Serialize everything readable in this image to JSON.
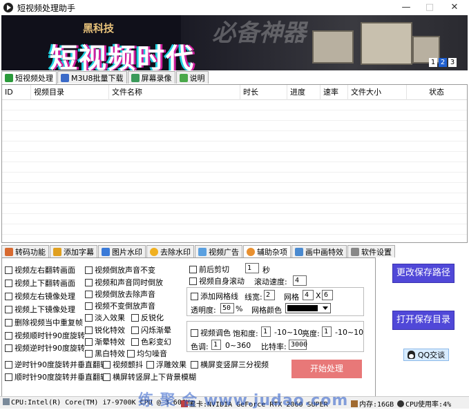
{
  "window": {
    "title": "短视频处理助手",
    "min": "—",
    "max": "□",
    "close": "✕"
  },
  "banner": {
    "tag": "黑科技",
    "headline": "短视频时代",
    "ghost_text": "必备神器",
    "pages": [
      "1",
      "2",
      "3"
    ],
    "active_page": 2
  },
  "top_tabs": [
    {
      "label": "短视频处理",
      "icon": "video-icon"
    },
    {
      "label": "M3U8批量下载",
      "icon": "grid-icon"
    },
    {
      "label": "屏幕录像",
      "icon": "screen-icon"
    },
    {
      "label": "说明",
      "icon": "help-icon"
    }
  ],
  "table": {
    "columns": [
      "ID",
      "视频目录",
      "文件名称",
      "时长",
      "进度",
      "速率",
      "文件大小",
      "状态"
    ]
  },
  "bottom_tabs": [
    {
      "label": "转码功能"
    },
    {
      "label": "添加字幕"
    },
    {
      "label": "图片水印"
    },
    {
      "label": "去除水印"
    },
    {
      "label": "视频广告"
    },
    {
      "label": "辅助杂项"
    },
    {
      "label": "画中画特效"
    },
    {
      "label": "软件设置"
    }
  ],
  "options": {
    "col1": [
      "视频左右翻转画面",
      "视频上下翻转画面",
      "视频左右镜像处理",
      "视频上下镜像处理",
      "删除视频当中重复帧",
      "视频顺时针90度旋转",
      "视频逆时针90度旋转"
    ],
    "col2": [
      "视频倒放声音不变",
      "视频和声音同时倒放",
      "视频倒放去除声音",
      "视频不变倒放声音",
      "淡入效果",
      "锐化特效",
      "渐晕特效",
      "黑白特效"
    ],
    "col3": [
      "反锐化",
      "闪烁渐晕",
      "色彩变幻",
      "均匀噪音"
    ],
    "row_a": [
      "逆时针90度旋转并垂直翻转",
      "视频颤抖",
      "浮雕效果",
      "横屏变竖屏三分视频"
    ],
    "row_b": [
      "顺时针90度旋转并垂直翻转",
      "横屏转竖屏上下背景模糊"
    ],
    "trim": {
      "label": "前后剪切",
      "value": "1",
      "unit": "秒"
    },
    "scroll": {
      "label": "视频自身滚动",
      "speed_label": "滚动速度:",
      "speed": "4"
    },
    "grid": {
      "label": "添加网格线",
      "width_label": "线宽:",
      "width": "2",
      "grid_label": "网格",
      "cols": "4",
      "x": "X",
      "rows": "6",
      "opacity_label": "透明度:",
      "opacity": "50",
      "opacity_unit": "%",
      "color_label": "网格颜色",
      "color": "#000000"
    },
    "tone": {
      "label": "视频调色",
      "sat_label": "饱和度:",
      "sat": "1",
      "sat_range": "-10~10",
      "bright_label": "亮度:",
      "bright": "1",
      "bright_range": "-10~10",
      "hue_label": "色调:",
      "hue": "1",
      "hue_range": "0~360",
      "bitrate_label": "比特率:",
      "bitrate": "3000"
    }
  },
  "buttons": {
    "save_path": "更改保存路径",
    "open_dir": "打开保存目录",
    "qq": "QQ交谈",
    "start": "开始处理"
  },
  "status": {
    "cpu": "CPU:Intel(R) Core(TM) i7-9700K CPU @ 3.60GHz",
    "gpu": "显卡:NVIDIA GeForce RTX 2060 SUPER",
    "mem": "内存:16GB",
    "usage": "CPU使用率:4%"
  },
  "watermark": "练 聚 合   www.judao.com"
}
